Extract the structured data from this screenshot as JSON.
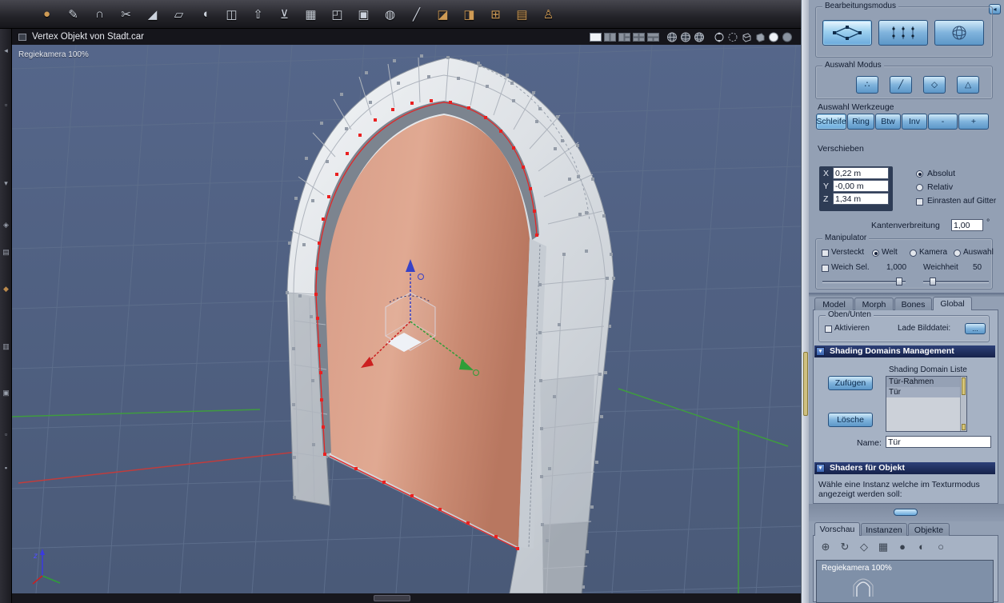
{
  "colors": {
    "accent": "#6aa9dc",
    "selection": "#e02828",
    "door": "#cf8f76",
    "header": "#1d2c55",
    "scroll_thumb": "#d6c578"
  },
  "toolbar": {
    "icons": [
      {
        "name": "sphere-tool",
        "glyph": "●"
      },
      {
        "name": "pen-tool",
        "glyph": "✎"
      },
      {
        "name": "magnet-tool",
        "glyph": "∩"
      },
      {
        "name": "scissors-tool",
        "glyph": "✂"
      },
      {
        "name": "bevel-tool",
        "glyph": "◢"
      },
      {
        "name": "marquee-tool",
        "glyph": "▱"
      },
      {
        "name": "dome-tool",
        "glyph": "◖"
      },
      {
        "name": "stamp-tool",
        "glyph": "◫"
      },
      {
        "name": "extrude-tool",
        "glyph": "⇧"
      },
      {
        "name": "lathe-tool",
        "glyph": "⊻"
      },
      {
        "name": "mesh-tool",
        "glyph": "▦"
      },
      {
        "name": "box-tool",
        "glyph": "◰"
      },
      {
        "name": "duplicate-tool",
        "glyph": "▣"
      },
      {
        "name": "uv-sphere-tool",
        "glyph": "◍"
      },
      {
        "name": "line-tool",
        "glyph": "╱"
      },
      {
        "name": "sweep-tool",
        "glyph": "◪"
      },
      {
        "name": "shell-tool",
        "glyph": "◨"
      },
      {
        "name": "grid-tool",
        "glyph": "⊞"
      },
      {
        "name": "plane-tool",
        "glyph": "▤"
      },
      {
        "name": "figure-tool",
        "glyph": "♙"
      }
    ]
  },
  "left_dock": {
    "icons": [
      {
        "name": "dock-collapse",
        "glyph": "◂"
      },
      {
        "name": "dock-tool-2",
        "glyph": "▫"
      },
      {
        "name": "dock-tool-3",
        "glyph": "▾"
      },
      {
        "name": "dock-tool-4",
        "glyph": "◈"
      },
      {
        "name": "dock-tool-5",
        "glyph": "▤"
      },
      {
        "name": "dock-tool-6",
        "glyph": "◆"
      },
      {
        "name": "dock-tool-7",
        "glyph": "▥"
      },
      {
        "name": "dock-tool-8",
        "glyph": "▣"
      },
      {
        "name": "dock-tool-9",
        "glyph": "▫"
      },
      {
        "name": "dock-tool-10",
        "glyph": "▪"
      }
    ]
  },
  "viewport": {
    "title": "Vertex Objekt von Stadt.car",
    "camera_label": "Regiekamera 100%",
    "axis_z": "z",
    "titlebar_icons": [
      "layout-single",
      "layout-2pane",
      "layout-3pane",
      "layout-4pane",
      "layout-4pane-alt",
      "wire-globe-1",
      "wire-globe-2",
      "wire-globe-3",
      "orbit-view",
      "dashed-circle",
      "wire-cube",
      "solid-cube",
      "shaded-sphere",
      "grey-sphere"
    ]
  },
  "panel": {
    "collapse_arrow": "◂",
    "bearbeitungsmodus": {
      "label": "Bearbeitungsmodus"
    },
    "auswahl_modus": {
      "label": "Auswahl Modus",
      "buttons": [
        {
          "name": "select-vertex",
          "glyph": "∴"
        },
        {
          "name": "select-edge",
          "glyph": "╱"
        },
        {
          "name": "select-polygon",
          "glyph": "◇"
        },
        {
          "name": "select-object",
          "glyph": "△"
        }
      ]
    },
    "auswahl_werkzeuge": {
      "label": "Auswahl Werkzeuge",
      "buttons": [
        "Schleife",
        "Ring",
        "Btw",
        "Inv",
        "-",
        "+"
      ]
    },
    "verschieben": {
      "label": "Verschieben",
      "x_label": "X",
      "y_label": "Y",
      "z_label": "Z",
      "x_value": "0,22 m",
      "y_value": "-0,00 m",
      "z_value": "1,34 m",
      "absolut": "Absolut",
      "relativ": "Relativ",
      "einrasten": "Einrasten auf Gitter",
      "kanten_label": "Kantenverbreitung",
      "kanten_value": "1,00",
      "kanten_unit": "°"
    },
    "manipulator": {
      "label": "Manipulator",
      "versteckt": "Versteckt",
      "welt": "Welt",
      "kamera": "Kamera",
      "auswahl": "Auswahl",
      "weich_sel": "Weich Sel.",
      "weich_value": "1,000",
      "weichheit_label": "Weichheit",
      "weichheit_value": "50"
    },
    "tabs": [
      "Model",
      "Morph",
      "Bones",
      "Global"
    ],
    "oben_unten": {
      "label": "Oben/Unten",
      "aktivieren": "Aktivieren",
      "lade_label": "Lade Bilddatei:",
      "browse": "..."
    },
    "shading": {
      "arrow": "▼",
      "header": "Shading Domains Management",
      "liste_label": "Shading Domain Liste",
      "zufuegen": "Zufügen",
      "loesche": "Lösche",
      "items": [
        "Tür-Rahmen",
        "Tür"
      ],
      "name_label": "Name:",
      "name_value": "Tür"
    },
    "shaders": {
      "arrow": "▼",
      "header": "Shaders für Objekt",
      "hint": "Wähle eine Instanz welche im Texturmodus angezeigt werden soll:"
    },
    "bottom_tabs": [
      "Vorschau",
      "Instanzen",
      "Objekte"
    ],
    "browser_icons": [
      {
        "name": "pan-view",
        "glyph": "⊕"
      },
      {
        "name": "rotate-view",
        "glyph": "↻"
      },
      {
        "name": "diamond-view",
        "glyph": "◇"
      },
      {
        "name": "grid-view",
        "glyph": "▦"
      },
      {
        "name": "shaded-sphere",
        "glyph": "●"
      },
      {
        "name": "half-sphere",
        "glyph": "◐"
      },
      {
        "name": "wire-sphere",
        "glyph": "○"
      }
    ],
    "preview": {
      "camera_label": "Regiekamera 100%"
    }
  }
}
